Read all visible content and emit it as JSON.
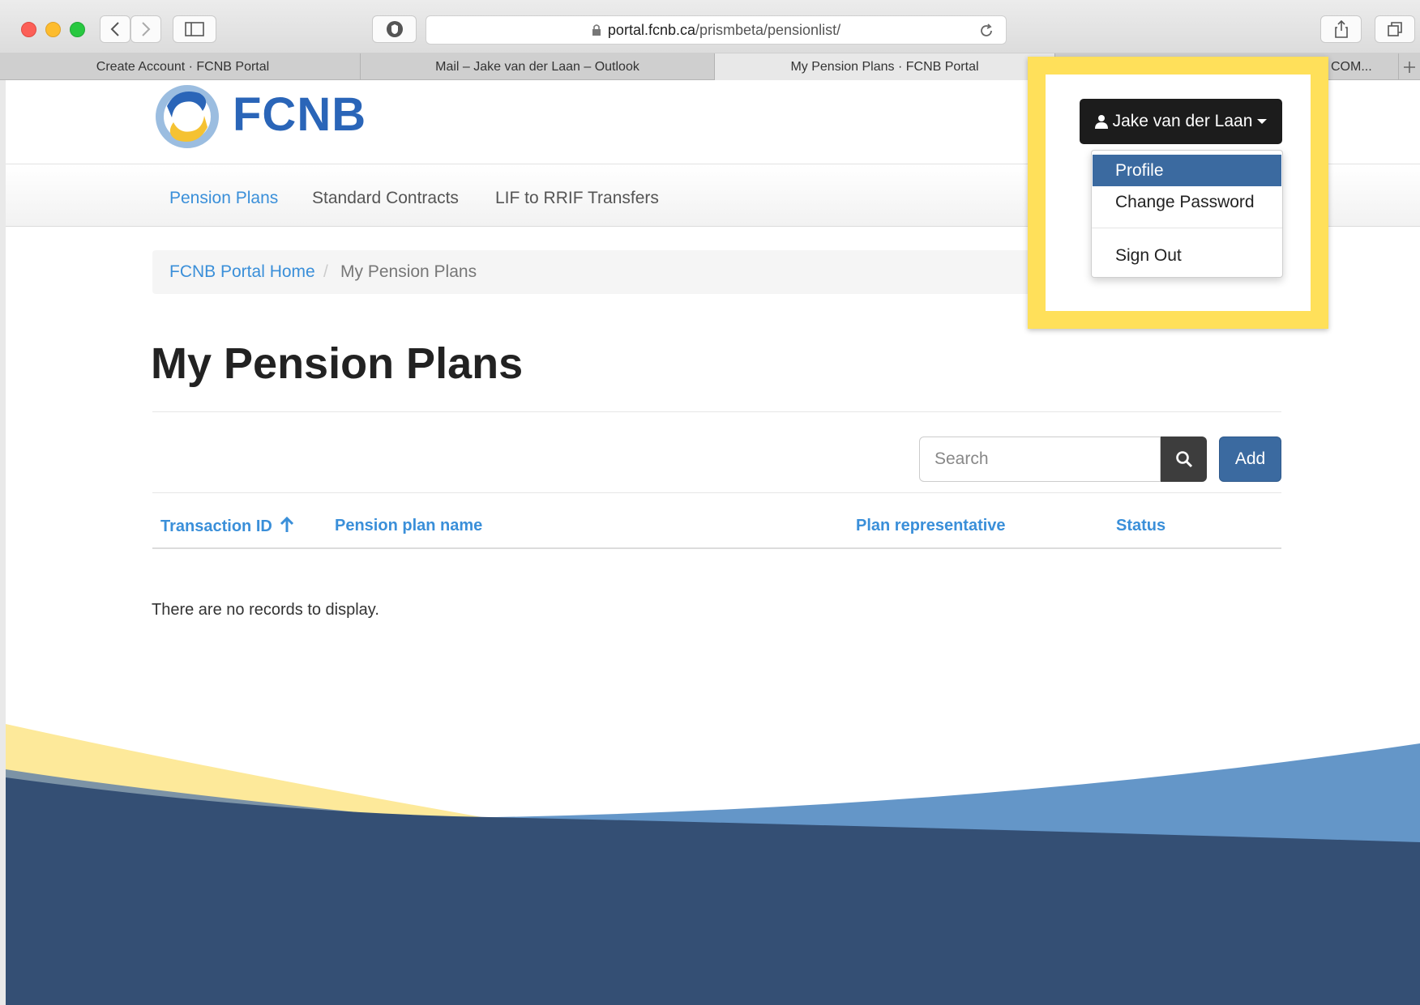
{
  "browser": {
    "url_host": "portal.fcnb.ca",
    "url_path": "/prismbeta/pensionlist/",
    "tabs": [
      {
        "label": "Create Account  · FCNB Portal"
      },
      {
        "label": "Mail – Jake van der Laan – Outlook"
      },
      {
        "label": "My Pension Plans  · FCNB Portal"
      },
      {
        "label": "COM..."
      }
    ]
  },
  "brand": {
    "logo_text": "FCNB"
  },
  "nav": {
    "items": [
      {
        "label": "Pension Plans"
      },
      {
        "label": "Standard Contracts"
      },
      {
        "label": "LIF to RRIF Transfers"
      }
    ]
  },
  "breadcrumb": {
    "home": "FCNB Portal Home",
    "separator": "/",
    "current": "My Pension Plans"
  },
  "page": {
    "title": "My Pension Plans"
  },
  "toolbar": {
    "search_placeholder": "Search",
    "add_label": "Add"
  },
  "table": {
    "columns": [
      {
        "label": "Transaction ID"
      },
      {
        "label": "Pension plan name"
      },
      {
        "label": "Plan representative"
      },
      {
        "label": "Status"
      }
    ],
    "empty_message": "There are no records to display."
  },
  "user_menu": {
    "user_name": "Jake van der Laan",
    "items": [
      {
        "label": "Profile"
      },
      {
        "label": "Change Password"
      },
      {
        "label": "Sign Out"
      }
    ]
  },
  "colors": {
    "brand_blue": "#2a65b8",
    "link_blue": "#3a8fd9",
    "highlight_yellow": "#ffe05a",
    "footer_navy": "#344f74"
  }
}
